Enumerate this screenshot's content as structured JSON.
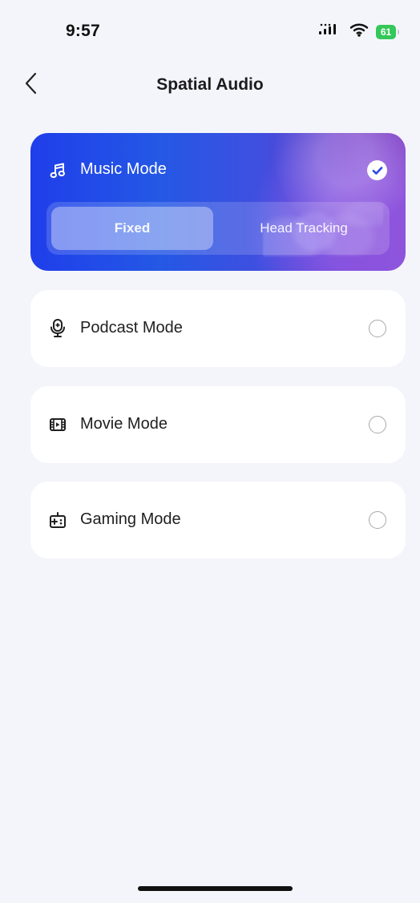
{
  "status_bar": {
    "time": "9:57",
    "battery": "61"
  },
  "nav": {
    "title": "Spatial Audio"
  },
  "modes": {
    "music": {
      "label": "Music Mode",
      "selected": true,
      "segments": {
        "fixed": "Fixed",
        "head_tracking": "Head Tracking",
        "active": "Fixed"
      }
    },
    "podcast": {
      "label": "Podcast Mode",
      "selected": false
    },
    "movie": {
      "label": "Movie Mode",
      "selected": false
    },
    "gaming": {
      "label": "Gaming Mode",
      "selected": false
    }
  },
  "icons": {
    "back": "chevron-left-icon",
    "music": "music-note-icon",
    "podcast": "microphone-icon",
    "movie": "film-icon",
    "gaming": "gamepad-icon",
    "selected": "checkmark-circle-icon",
    "signal": "cellular-signal-icon",
    "wifi": "wifi-icon",
    "battery": "battery-icon"
  },
  "colors": {
    "background": "#f4f5fa",
    "card": "#ffffff",
    "selected_gradient_start": "#1f3eea",
    "selected_gradient_end": "#7c3cc0",
    "battery": "#34c759"
  }
}
